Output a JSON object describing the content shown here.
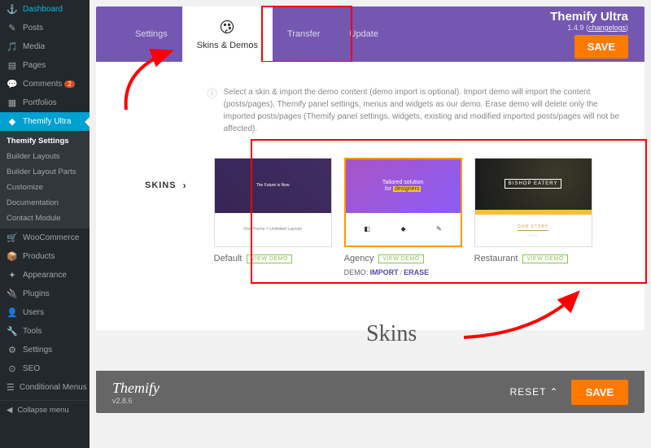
{
  "wp_menu": [
    {
      "icon": "⚓",
      "label": "Dashboard"
    },
    {
      "icon": "✎",
      "label": "Posts"
    },
    {
      "icon": "🎵",
      "label": "Media"
    },
    {
      "icon": "▤",
      "label": "Pages"
    },
    {
      "icon": "💬",
      "label": "Comments",
      "badge": "2"
    },
    {
      "icon": "▦",
      "label": "Portfolios"
    },
    {
      "icon": "◆",
      "label": "Themify Ultra",
      "active": true
    }
  ],
  "wp_submenu": [
    {
      "label": "Themify Settings",
      "active": true
    },
    {
      "label": "Builder Layouts"
    },
    {
      "label": "Builder Layout Parts"
    },
    {
      "label": "Customize"
    },
    {
      "label": "Documentation"
    },
    {
      "label": "Contact Module"
    }
  ],
  "wp_menu2": [
    {
      "icon": "🛒",
      "label": "WooCommerce"
    },
    {
      "icon": "📦",
      "label": "Products"
    },
    {
      "icon": "✦",
      "label": "Appearance"
    },
    {
      "icon": "🔌",
      "label": "Plugins"
    },
    {
      "icon": "👤",
      "label": "Users"
    },
    {
      "icon": "🔧",
      "label": "Tools"
    },
    {
      "icon": "⚙",
      "label": "Settings"
    },
    {
      "icon": "⊙",
      "label": "SEO"
    },
    {
      "icon": "☰",
      "label": "Conditional Menus"
    }
  ],
  "collapse_label": "Collapse menu",
  "panel": {
    "tabs": [
      {
        "label": "Settings"
      },
      {
        "label": "Skins & Demos",
        "active": true,
        "icon": "🎨"
      },
      {
        "label": "Transfer"
      },
      {
        "label": "Update"
      }
    ],
    "title": "Themify Ultra",
    "version": "1.4.9",
    "changelogs": "changelogs",
    "save": "SAVE"
  },
  "section": {
    "label": "SKINS",
    "info": "Select a skin & import the demo content (demo import is optional). Import demo will import the content (posts/pages), Themify panel settings, menus and widgets as our demo. Erase demo will delete only the imported posts/pages (Themify panel settings, widgets, existing and modified imported posts/pages will not be affected)."
  },
  "skins": [
    {
      "name": "Default",
      "view_demo": "VIEW DEMO",
      "thumb": {
        "line1": "One Theme = Unlimited Layouts"
      }
    },
    {
      "name": "Agency",
      "view_demo": "VIEW DEMO",
      "selected": true,
      "demo_label": "DEMO:",
      "import": "IMPORT",
      "erase": "ERASE",
      "thumb": {
        "line1": "Tailored solution",
        "line2": "for designers"
      }
    },
    {
      "name": "Restaurant",
      "view_demo": "VIEW DEMO",
      "thumb": {
        "name": "BISHOP EATERY",
        "story": "OUR STORY"
      }
    }
  ],
  "footer": {
    "brand": "Themify",
    "version": "v2.8.6",
    "reset": "RESET",
    "save": "SAVE"
  },
  "annotation": {
    "skins_label": "Skins"
  }
}
